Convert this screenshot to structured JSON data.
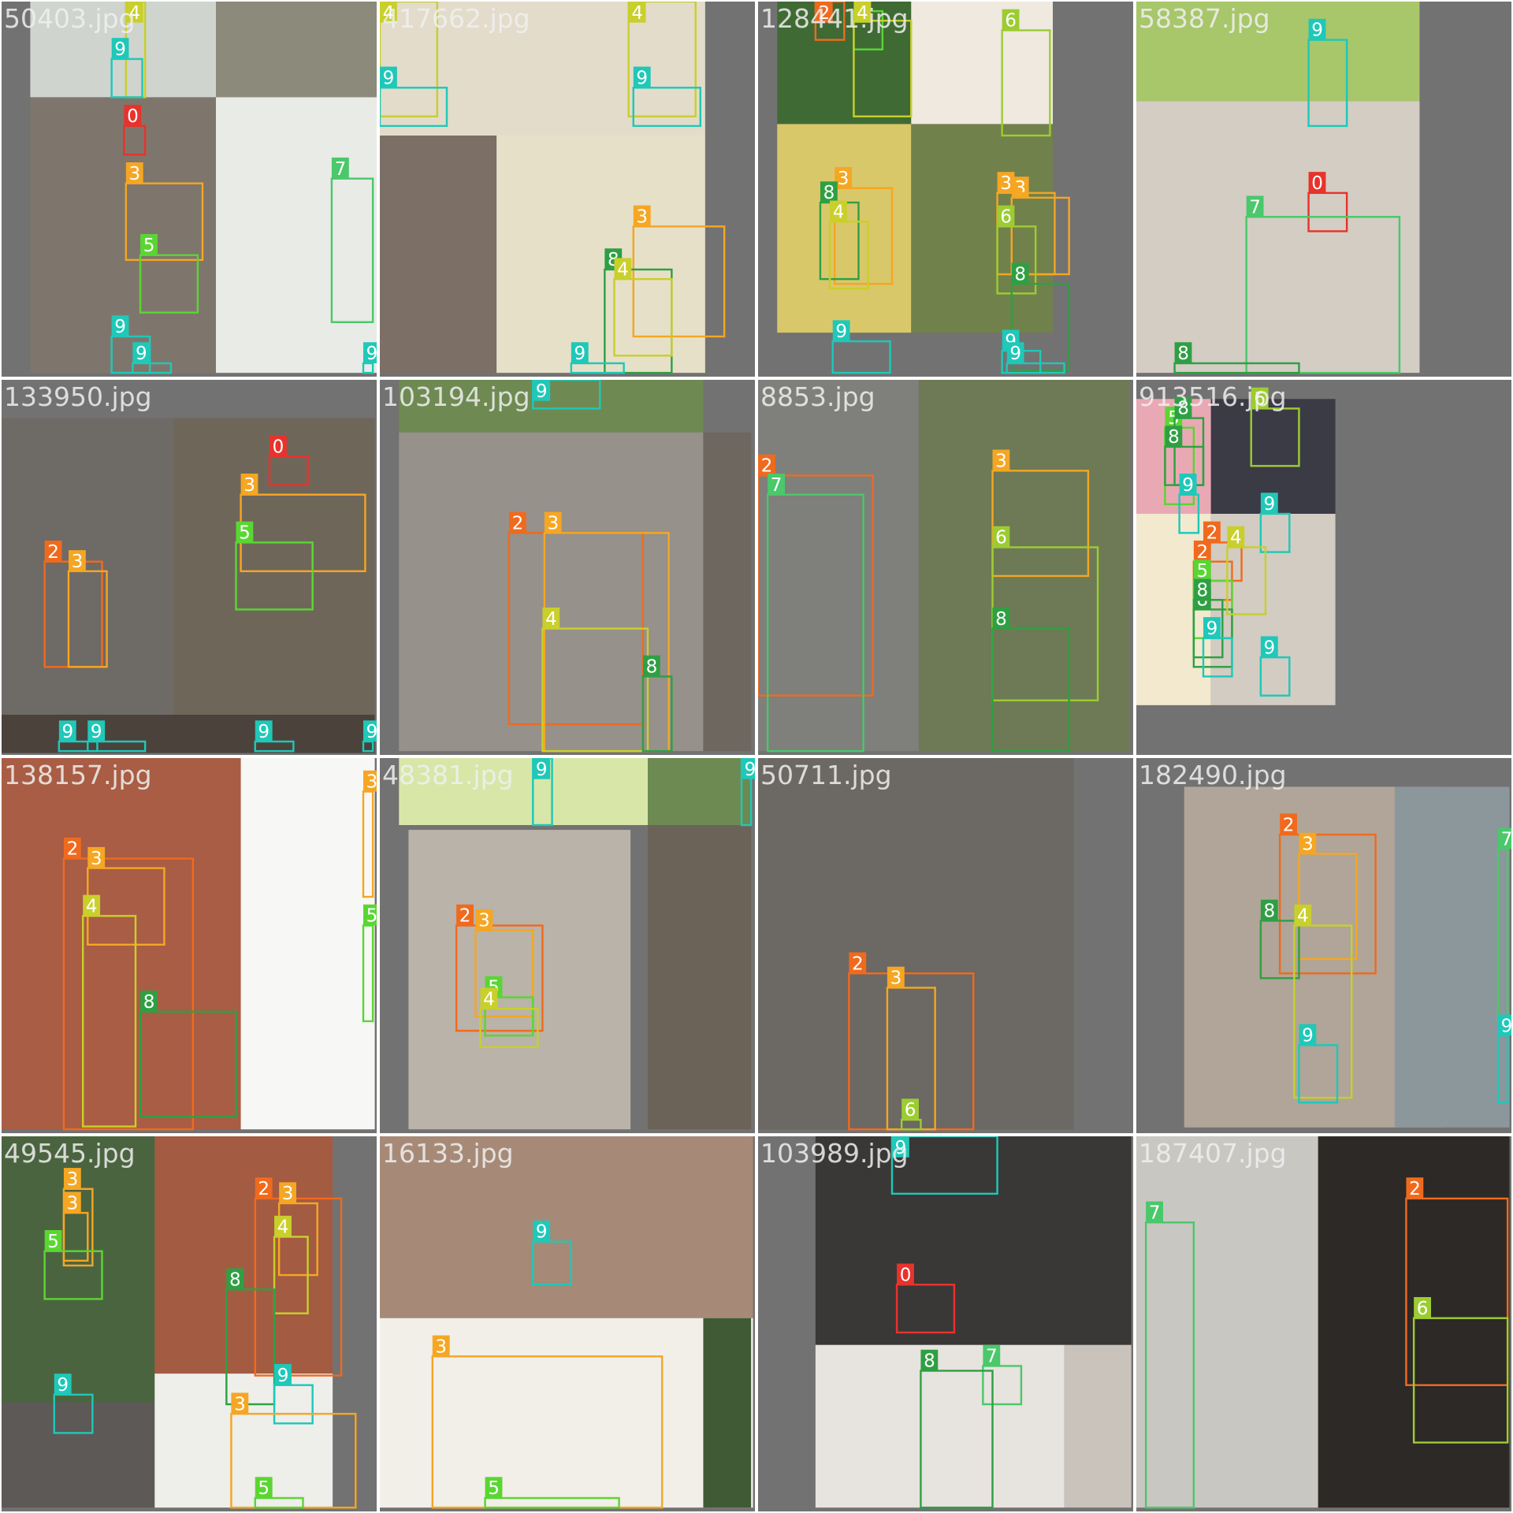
{
  "class_colors": {
    "0": "#e8322c",
    "2": "#f06a1e",
    "3": "#f5a623",
    "4": "#c9cf2b",
    "5": "#5ad632",
    "6": "#9ccc32",
    "7": "#4ac86a",
    "8": "#2ea043",
    "9": "#1fc8b8"
  },
  "tiles": [
    {
      "filename": "50403.jpg",
      "detections": [
        "4",
        "9",
        "9",
        "0",
        "3",
        "5",
        "7",
        "9",
        "9"
      ]
    },
    {
      "filename": "417662.jpg",
      "detections": [
        "4",
        "4",
        "9",
        "9",
        "3",
        "8",
        "4",
        "9"
      ]
    },
    {
      "filename": "128441.jpg",
      "detections": [
        "2",
        "5",
        "4",
        "3",
        "6",
        "9",
        "3",
        "8",
        "4",
        "3",
        "6",
        "8",
        "9",
        "9"
      ]
    },
    {
      "filename": "58387.jpg",
      "detections": [
        "9",
        "0",
        "7",
        "8"
      ]
    },
    {
      "filename": "133950.jpg",
      "detections": [
        "0",
        "3",
        "5",
        "2",
        "3",
        "9",
        "9",
        "9",
        "9"
      ]
    },
    {
      "filename": "103194.jpg",
      "detections": [
        "9",
        "2",
        "3",
        "4",
        "8"
      ]
    },
    {
      "filename": "8853.jpg",
      "detections": [
        "2",
        "7",
        "3",
        "6",
        "8"
      ]
    },
    {
      "filename": "913516.jpg",
      "detections": [
        "5",
        "8",
        "8",
        "6",
        "9",
        "9",
        "2",
        "2",
        "5",
        "8",
        "4",
        "8",
        "9",
        "9"
      ]
    },
    {
      "filename": "138157.jpg",
      "detections": [
        "3",
        "2",
        "3",
        "4",
        "8",
        "5"
      ]
    },
    {
      "filename": "48381.jpg",
      "detections": [
        "9",
        "9",
        "2",
        "3",
        "5",
        "4"
      ]
    },
    {
      "filename": "50711.jpg",
      "detections": [
        "2",
        "3",
        "6"
      ]
    },
    {
      "filename": "182490.jpg",
      "detections": [
        "2",
        "3",
        "8",
        "4",
        "9",
        "7",
        "9"
      ]
    },
    {
      "filename": "49545.jpg",
      "detections": [
        "3",
        "3",
        "5",
        "2",
        "3",
        "4",
        "8",
        "9",
        "9",
        "3",
        "5"
      ]
    },
    {
      "filename": "16133.jpg",
      "detections": [
        "9",
        "3",
        "5"
      ]
    },
    {
      "filename": "103989.jpg",
      "detections": [
        "9",
        "0",
        "7",
        "8"
      ]
    },
    {
      "filename": "187407.jpg",
      "detections": [
        "7",
        "2",
        "6"
      ]
    }
  ]
}
